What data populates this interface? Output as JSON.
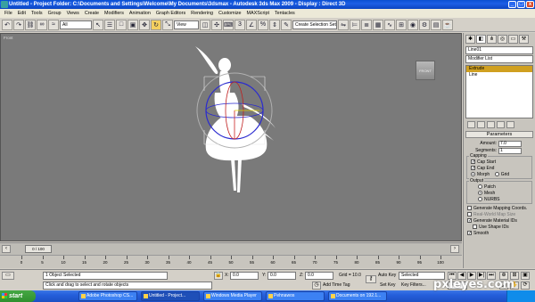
{
  "window": {
    "title": "Untitled   - Project Folder: C:\\Documents and Settings\\Welcome\\My Documents\\3dsmax    - Autodesk 3ds Max  2009         - Display : Direct 3D",
    "min": "_",
    "max": "□",
    "close": "x"
  },
  "menu": [
    "File",
    "Edit",
    "Tools",
    "Group",
    "Views",
    "Create",
    "Modifiers",
    "Animation",
    "Graph Editors",
    "Rendering",
    "Customize",
    "MAXScript",
    "Tentacles"
  ],
  "toolbar": {
    "filter_select": "All",
    "view_select": "View",
    "selection_set_placeholder": "Create Selection Set"
  },
  "viewport": {
    "label": "Front",
    "viewcube_label": "FRONT",
    "background": "#7a7a7a"
  },
  "command_panel": {
    "tab_icons": [
      "create-icon",
      "modify-icon",
      "hierarchy-icon",
      "motion-icon",
      "display-icon",
      "utilities-icon"
    ],
    "object_name": "Line01",
    "modifier_list": "Modifier List",
    "stack": [
      {
        "label": "Extrude",
        "highlight": true
      },
      {
        "label": "Line",
        "highlight": false
      }
    ],
    "rollout_title": "Parameters",
    "amount_label": "Amount:",
    "amount_value": "7.0",
    "segments_label": "Segments:",
    "segments_value": "1",
    "capping_label": "Capping",
    "cap_start": "Cap Start",
    "cap_end": "Cap End",
    "morph": "Morph",
    "grid": "Grid",
    "output_label": "Output",
    "output_patch": "Patch",
    "output_mesh": "Mesh",
    "output_nurbs": "NURBS",
    "gen_mapping": "Generate Mapping Coords.",
    "real_world": "Real-World Map Size",
    "gen_material": "Generate Material IDs",
    "use_shape": "Use Shape IDs",
    "smooth": "Smooth"
  },
  "timeline": {
    "position": "0 / 100",
    "ticks": [
      "0",
      "5",
      "10",
      "15",
      "20",
      "25",
      "30",
      "35",
      "40",
      "45",
      "50",
      "55",
      "60",
      "65",
      "70",
      "75",
      "80",
      "85",
      "90",
      "95",
      "100"
    ]
  },
  "status": {
    "selection": "1 Object Selected",
    "prompt": "Click and drag to select and rotate objects",
    "x_label": "X:",
    "x_value": "0.0",
    "y_label": "Y:",
    "y_value": "0.0",
    "z_label": "Z:",
    "z_value": "0.0",
    "grid": "Grid = 10.0",
    "add_time_tag": "Add Time Tag",
    "auto_key": "Auto Key",
    "set_key": "Set Key",
    "key_mode": "Selected",
    "key_filters": "Key Filters...",
    "frame": "0"
  },
  "taskbar": {
    "start": "start",
    "tasks": [
      {
        "label": "Adobe Photoshop CS..."
      },
      {
        "label": "Untitled   - Project..."
      },
      {
        "label": "Windows Media Player"
      },
      {
        "label": "Pehnawos"
      },
      {
        "label": "Documents on 192.1..."
      }
    ]
  },
  "watermark": "pxleyes.com"
}
